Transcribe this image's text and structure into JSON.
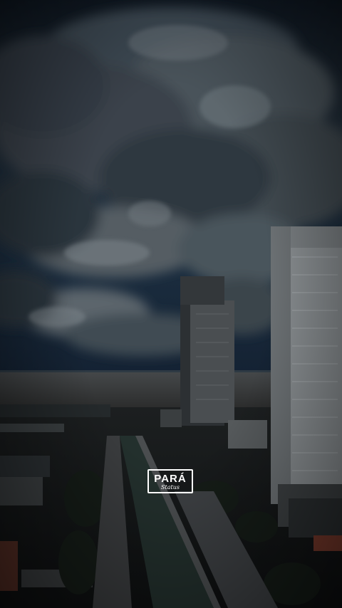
{
  "scene": {
    "description_icon": "city-skyline-photo",
    "sky_color": "#1d2b3a",
    "water_color": "#3a3d3f"
  },
  "watermark": {
    "title": "PARÁ",
    "subtitle": "Status"
  }
}
